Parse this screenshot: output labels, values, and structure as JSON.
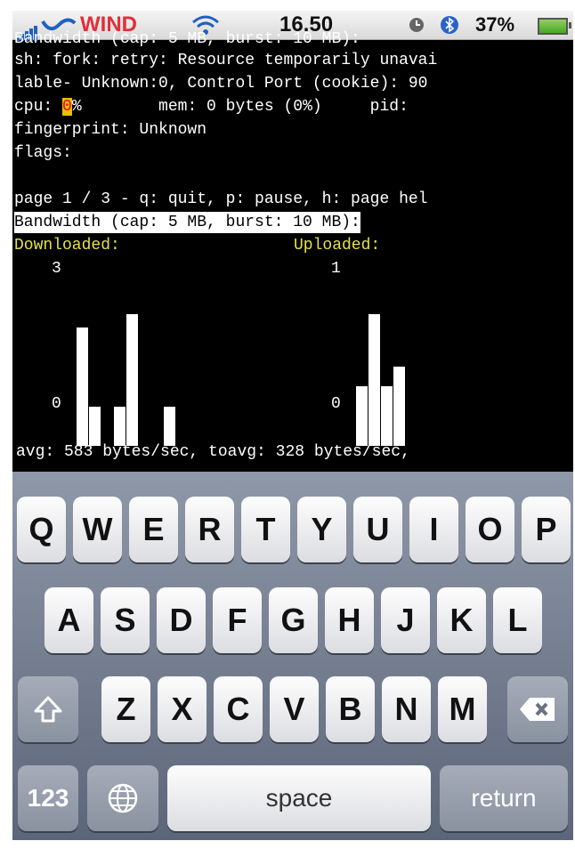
{
  "status_bar": {
    "carrier": "WIND",
    "time": "16.50",
    "battery_percent": "37%",
    "battery_level": 0.37,
    "icons": [
      "signal-icon",
      "carrier-wave-icon",
      "wifi-icon",
      "clock-icon",
      "bluetooth-icon",
      "battery-charging-icon"
    ]
  },
  "terminal": {
    "lines": [
      "sh: fork: retry: Resource temporarily unavai",
      "lable- Unknown:0, Control Port (cookie): 90",
      "fingerprint: Unknown",
      "flags:",
      "page 1 / 3 - q: quit, p: pause, h: page hel",
      "Bandwidth (cap: 5 MB, burst: 10 MB):"
    ],
    "cpu_label": "cpu: ",
    "cpu_value": "0",
    "cpu_rest": "%        mem: 0 bytes (0%)     pid:",
    "downloaded_label": "Downloaded:",
    "uploaded_label": "Uploaded:",
    "download_max": "3",
    "download_min": "0",
    "upload_max": "1",
    "upload_min": "0",
    "download_bars": [
      2.7,
      0.9,
      0,
      0.9,
      3.0,
      0,
      0,
      0.9
    ],
    "upload_bars": [
      0.45,
      1.0,
      0.45,
      0.6
    ],
    "avg_line": "avg: 583 bytes/sec, toavg: 328 bytes/sec,"
  },
  "keyboard": {
    "row1": [
      "Q",
      "W",
      "E",
      "R",
      "T",
      "Y",
      "U",
      "I",
      "O",
      "P"
    ],
    "row2": [
      "A",
      "S",
      "D",
      "F",
      "G",
      "H",
      "J",
      "K",
      "L"
    ],
    "row3": [
      "Z",
      "X",
      "C",
      "V",
      "B",
      "N",
      "M"
    ],
    "numbers_key": "123",
    "space_key": "space",
    "return_key": "return",
    "icons": [
      "shift-icon",
      "backspace-icon",
      "globe-icon"
    ]
  }
}
